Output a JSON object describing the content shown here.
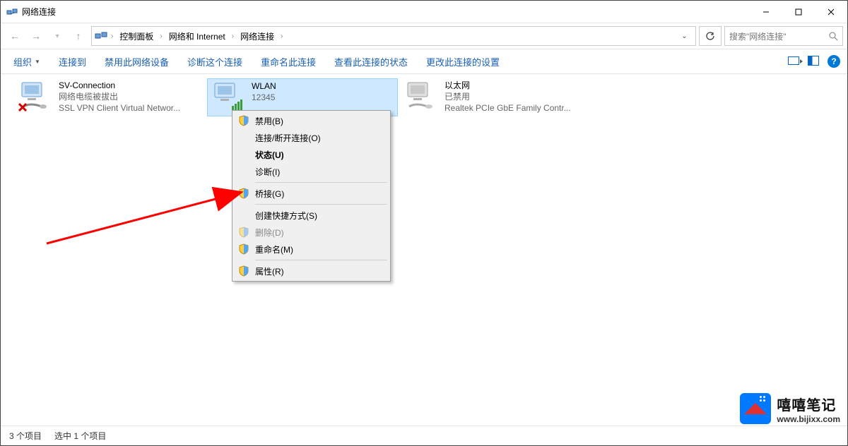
{
  "window": {
    "title": "网络连接"
  },
  "breadcrumb": {
    "root_sep": "›",
    "items": [
      "控制面板",
      "网络和 Internet",
      "网络连接"
    ]
  },
  "search": {
    "placeholder": "搜索\"网络连接\""
  },
  "toolbar": {
    "organize": "组织",
    "connect_to": "连接到",
    "disable_device": "禁用此网络设备",
    "diagnose": "诊断这个连接",
    "rename": "重命名此连接",
    "view_status": "查看此连接的状态",
    "change_settings": "更改此连接的设置"
  },
  "adapters": [
    {
      "name": "SV-Connection",
      "status": "网络电缆被拔出",
      "detail": "SSL VPN Client Virtual Networ..."
    },
    {
      "name": "WLAN",
      "status": "12345",
      "detail": ""
    },
    {
      "name": "以太网",
      "status": "已禁用",
      "detail": "Realtek PCIe GbE Family Contr..."
    }
  ],
  "context_menu": {
    "disable": "禁用(B)",
    "connect_disconnect": "连接/断开连接(O)",
    "status": "状态(U)",
    "diagnose": "诊断(I)",
    "bridge": "桥接(G)",
    "create_shortcut": "创建快捷方式(S)",
    "delete": "删除(D)",
    "rename": "重命名(M)",
    "properties": "属性(R)"
  },
  "statusbar": {
    "item_count": "3 个项目",
    "selected_count": "选中 1 个项目"
  },
  "watermark": {
    "title": "嘻嘻笔记",
    "url": "www.bijixx.com"
  }
}
